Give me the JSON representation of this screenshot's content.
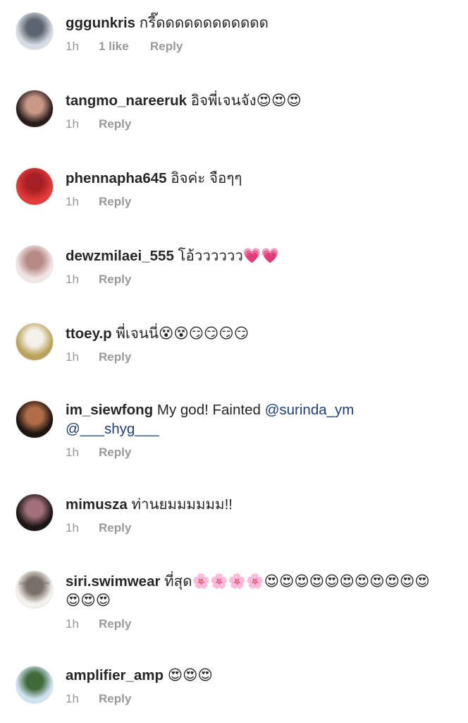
{
  "comments": [
    {
      "username": "gggunkris",
      "text": "กรี๊ดดดดดดดดดดดด",
      "mention_line": "",
      "time": "1h",
      "likes": "1 like",
      "reply": "Reply",
      "avatar_colors": [
        "#d7dce2",
        "#5b6471"
      ]
    },
    {
      "username": "tangmo_nareeruk",
      "text": "อิจพี่เจนจัง😍😍😍",
      "mention_line": "",
      "time": "1h",
      "likes": "",
      "reply": "Reply",
      "avatar_colors": [
        "#2b1c1c",
        "#c89a86"
      ]
    },
    {
      "username": "phennapha645",
      "text": "อิจค่ะ จือๆๆ",
      "mention_line": "",
      "time": "1h",
      "likes": "",
      "reply": "Reply",
      "avatar_colors": [
        "#e23b3b",
        "#a61f24"
      ]
    },
    {
      "username": "dewzmilaei_555",
      "text": "โอ้วววววว💗💗",
      "mention_line": "",
      "time": "1h",
      "likes": "",
      "reply": "Reply",
      "avatar_colors": [
        "#f1e5e5",
        "#b88a86"
      ]
    },
    {
      "username": "ttoey.p",
      "text": "พี่เจนนี่😵😵😏😏😏😏",
      "mention_line": "",
      "time": "1h",
      "likes": "",
      "reply": "Reply",
      "avatar_colors": [
        "#b9a25b",
        "#f4f1ea"
      ]
    },
    {
      "username": "im_siewfong",
      "text": "My god! Fainted ",
      "mention": "@surinda_ym",
      "mention_line": "@___shyg___",
      "time": "1h",
      "likes": "",
      "reply": "Reply",
      "avatar_colors": [
        "#1c1410",
        "#b06d47"
      ]
    },
    {
      "username": "mimusza",
      "text": "ท่านยมมมมมม!!",
      "mention_line": "",
      "time": "1h",
      "likes": "",
      "reply": "Reply",
      "avatar_colors": [
        "#1b1516",
        "#a1707a"
      ]
    },
    {
      "username": "siri.swimwear",
      "text": "ที่สุด🌸🌸🌸🌸😍😍😍😍😍😍😍😍😍😍😍😍😍😍",
      "mention_line": "",
      "time": "1h",
      "likes": "",
      "reply": "Reply",
      "avatar_colors": [
        "#f3f2ef",
        "#7a7068"
      ],
      "avatar_label": "SIRISWIMWEAR"
    },
    {
      "username": "amplifier_amp",
      "text": "😍😍😍",
      "mention_line": "",
      "time": "1h",
      "likes": "",
      "reply": "Reply",
      "avatar_colors": [
        "#cfe2f1",
        "#3f6a3a"
      ]
    }
  ]
}
